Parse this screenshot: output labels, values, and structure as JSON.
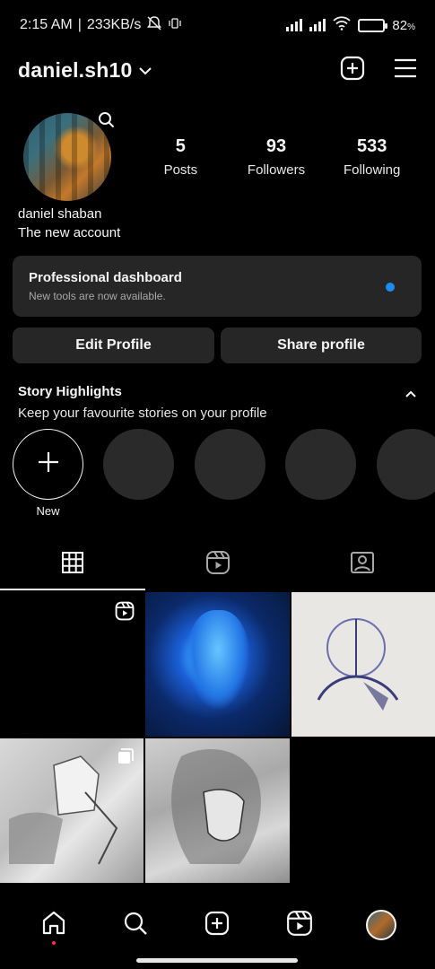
{
  "status_bar": {
    "time": "2:15 AM",
    "separator": "|",
    "net_speed": "233KB/s",
    "battery": "82",
    "battery_unit": "%",
    "battery_level": 0.82,
    "battery_color": "#37d84b"
  },
  "header": {
    "username": "daniel.sh10",
    "icons": [
      "chevron-down-icon",
      "create-post-icon",
      "menu-icon"
    ]
  },
  "profile": {
    "full_name": "daniel shaban",
    "bio": "The new account",
    "stats": [
      {
        "value": "5",
        "label": "Posts"
      },
      {
        "value": "93",
        "label": "Followers"
      },
      {
        "value": "533",
        "label": "Following"
      }
    ]
  },
  "dashboard": {
    "title": "Professional dashboard",
    "subtitle": "New tools are now available.",
    "dot_color": "#1d8cf0"
  },
  "buttons": {
    "edit": "Edit Profile",
    "share": "Share profile"
  },
  "highlights": {
    "title": "Story Highlights",
    "subtitle": "Keep your favourite stories on your profile",
    "new_label": "New"
  },
  "tabs": [
    "grid-icon",
    "reels-icon",
    "tagged-icon"
  ],
  "grid": [
    {
      "kind": "reel"
    },
    {
      "kind": "photo"
    },
    {
      "kind": "photo"
    },
    {
      "kind": "carousel"
    },
    {
      "kind": "photo"
    }
  ],
  "nav": [
    "home-icon",
    "search-icon",
    "create-icon",
    "reels-icon",
    "profile-avatar"
  ],
  "colors": {
    "background": "#000000",
    "surface": "#262626",
    "accent_blue": "#1d8cf0",
    "notification_red": "#ff3040"
  }
}
